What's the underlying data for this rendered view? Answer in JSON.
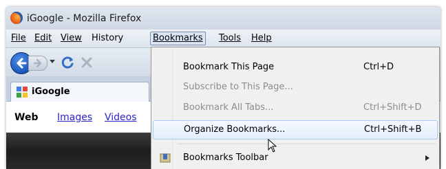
{
  "window": {
    "title": "iGoogle - Mozilla Firefox"
  },
  "menubar": {
    "items": [
      {
        "label": "File"
      },
      {
        "label": "Edit"
      },
      {
        "label": "View"
      },
      {
        "label": "History"
      },
      {
        "label": "Bookmarks",
        "active": true
      },
      {
        "label": "Tools"
      },
      {
        "label": "Help"
      }
    ]
  },
  "navbar": {
    "back_icon": "back-arrow-icon",
    "forward_icon": "forward-arrow-icon",
    "reload_icon": "reload-icon",
    "stop_icon": "stop-icon"
  },
  "tab": {
    "label": "iGoogle"
  },
  "content": {
    "links": [
      {
        "label": "Web",
        "selected": true
      },
      {
        "label": "Images"
      },
      {
        "label": "Videos"
      }
    ]
  },
  "bookmarks_menu": {
    "items": [
      {
        "label": "Bookmark This Page",
        "shortcut": "Ctrl+D",
        "enabled": true
      },
      {
        "label": "Subscribe to This Page...",
        "shortcut": "",
        "enabled": false
      },
      {
        "label": "Bookmark All Tabs...",
        "shortcut": "Ctrl+Shift+D",
        "enabled": false
      },
      {
        "label": "Organize Bookmarks...",
        "shortcut": "Ctrl+Shift+B",
        "enabled": true,
        "hovered": true
      },
      {
        "label": "Bookmarks Toolbar",
        "shortcut": "",
        "enabled": true,
        "submenu": true
      }
    ]
  },
  "colors": {
    "chrome_bg": "#d3dbe6",
    "link_blue": "#2a22cc",
    "hover_border": "#a8c8ee",
    "disabled_text": "#8d8d8d"
  }
}
